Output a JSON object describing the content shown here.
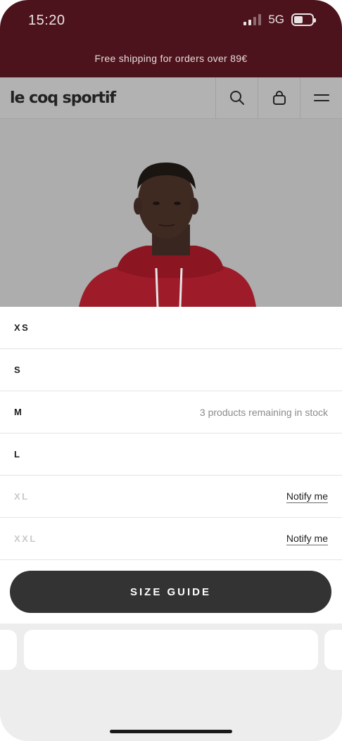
{
  "status_bar": {
    "time": "15:20",
    "network": "5G"
  },
  "promo": {
    "text": "Free shipping for orders over 89€"
  },
  "header": {
    "logo": "le coq sportif",
    "icons": [
      "search-icon",
      "bag-icon",
      "menu-icon"
    ]
  },
  "sizes": [
    {
      "label": "XS",
      "available": true,
      "note": "",
      "action": ""
    },
    {
      "label": "S",
      "available": true,
      "note": "",
      "action": ""
    },
    {
      "label": "M",
      "available": true,
      "note": "3 products remaining in stock",
      "action": ""
    },
    {
      "label": "L",
      "available": true,
      "note": "",
      "action": ""
    },
    {
      "label": "XL",
      "available": false,
      "note": "",
      "action": "Notify me"
    },
    {
      "label": "XXL",
      "available": false,
      "note": "",
      "action": "Notify me"
    }
  ],
  "size_guide": {
    "label": "SIZE GUIDE"
  },
  "colors": {
    "banner": "#4d131c",
    "header": "#b2b2b2",
    "button": "#333333",
    "hoodie": "#9e1c2a"
  }
}
